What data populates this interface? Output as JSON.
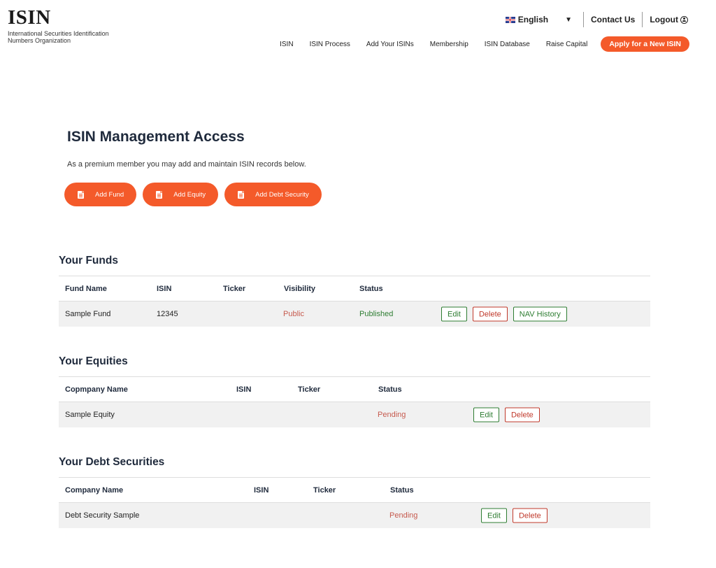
{
  "header": {
    "logo_mark": "ISIN",
    "logo_sub": "International Securities Identification Numbers Organization",
    "language": "English",
    "contact": "Contact Us",
    "logout": "Logout",
    "nav": [
      "ISIN",
      "ISIN Process",
      "Add Your ISINs",
      "Membership",
      "ISIN Database",
      "Raise Capital"
    ],
    "apply": "Apply for a New ISIN"
  },
  "main": {
    "title": "ISIN Management Access",
    "description": "As a premium member you may add and maintain ISIN records below.",
    "actions": [
      "Add Fund",
      "Add Equity",
      "Add Debt Security"
    ]
  },
  "funds": {
    "title": "Your Funds",
    "headers": [
      "Fund Name",
      "ISIN",
      "Ticker",
      "Visibility",
      "Status"
    ],
    "rows": [
      {
        "name": "Sample Fund",
        "isin": "12345",
        "ticker": "",
        "visibility": "Public",
        "status": "Published"
      }
    ],
    "buttons": [
      "Edit",
      "Delete",
      "NAV History"
    ]
  },
  "equities": {
    "title": "Your Equities",
    "headers": [
      "Copmpany Name",
      "ISIN",
      "Ticker",
      "Status"
    ],
    "rows": [
      {
        "name": "Sample Equity",
        "isin": "",
        "ticker": "",
        "status": "Pending"
      }
    ],
    "buttons": [
      "Edit",
      "Delete"
    ]
  },
  "debts": {
    "title": "Your Debt Securities",
    "headers": [
      "Company Name",
      "ISIN",
      "Ticker",
      "Status"
    ],
    "rows": [
      {
        "name": "Debt Security Sample",
        "isin": "",
        "ticker": "",
        "status": "Pending"
      }
    ],
    "buttons": [
      "Edit",
      "Delete"
    ]
  },
  "colors": {
    "accent": "#f45a2a",
    "success": "#2e7d32",
    "danger": "#c0392b"
  }
}
